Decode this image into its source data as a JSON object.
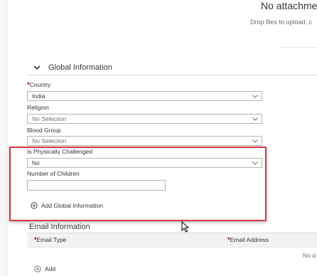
{
  "attachments": {
    "title": "No attachmer",
    "subtitle": "Drop files to upload, c"
  },
  "global_section": {
    "title": "Global Information",
    "icon": "chevron-down-icon"
  },
  "fields": {
    "country": {
      "required_mark": "*",
      "label": "Country",
      "value": "India"
    },
    "religion": {
      "label": "Religion",
      "value": "No Selection"
    },
    "blood_group": {
      "label": "Blood Group",
      "value": "No Selection"
    },
    "physically_challenged": {
      "label": "Is Physically Challenged",
      "value": "No"
    },
    "children": {
      "label": "Number of Children",
      "value": ""
    }
  },
  "add_global_label": "Add Global Information",
  "email_section": {
    "title": "Email Information",
    "columns": [
      {
        "required_mark": "*",
        "label": "Email Type"
      },
      {
        "required_mark": "*",
        "label": "Email Address"
      }
    ],
    "no_data": "No d",
    "add_label": "Add"
  },
  "colors": {
    "highlight": "#d9363e",
    "required": "#bb0000",
    "text": "#32363a",
    "header_bg": "#f2f2f2"
  }
}
